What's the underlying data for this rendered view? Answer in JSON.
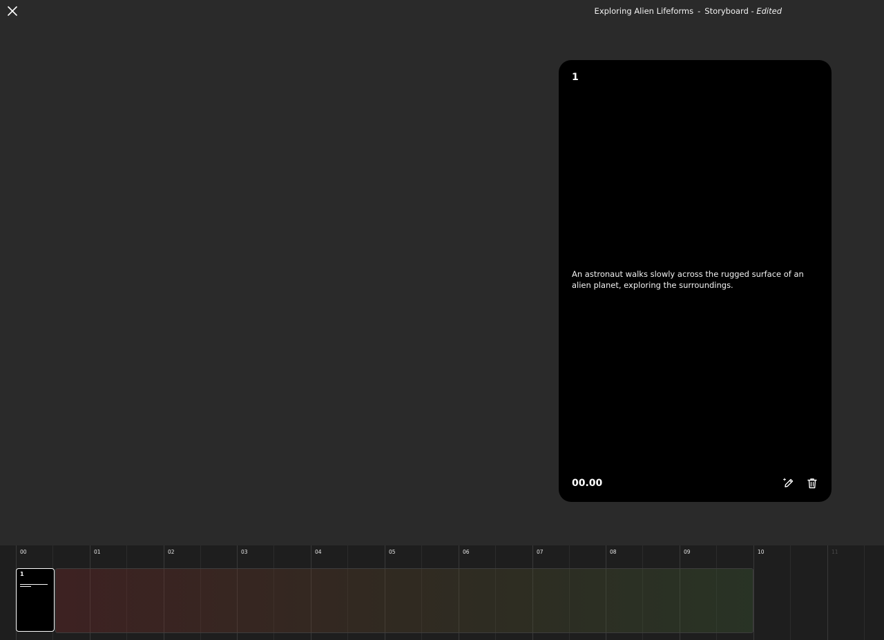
{
  "header": {
    "close_icon": "close-icon",
    "project_name": "Exploring Alien Lifeforms",
    "separator": "-",
    "view_name": "Storyboard",
    "status": "Edited"
  },
  "card": {
    "index": "1",
    "description": "An astronaut walks slowly across the rugged surface of an alien planet, exploring the surroundings.",
    "timestamp": "00.00",
    "edit_icon": "magic-pencil-icon",
    "delete_icon": "trash-icon"
  },
  "timeline": {
    "ticks": [
      "00",
      "01",
      "02",
      "03",
      "04",
      "05",
      "06",
      "07",
      "08",
      "09",
      "10",
      "11"
    ],
    "clip": {
      "index": "1"
    }
  },
  "colors": {
    "background": "#2a2a2a",
    "card": "#000000",
    "timeline": "#1e1e1e"
  }
}
